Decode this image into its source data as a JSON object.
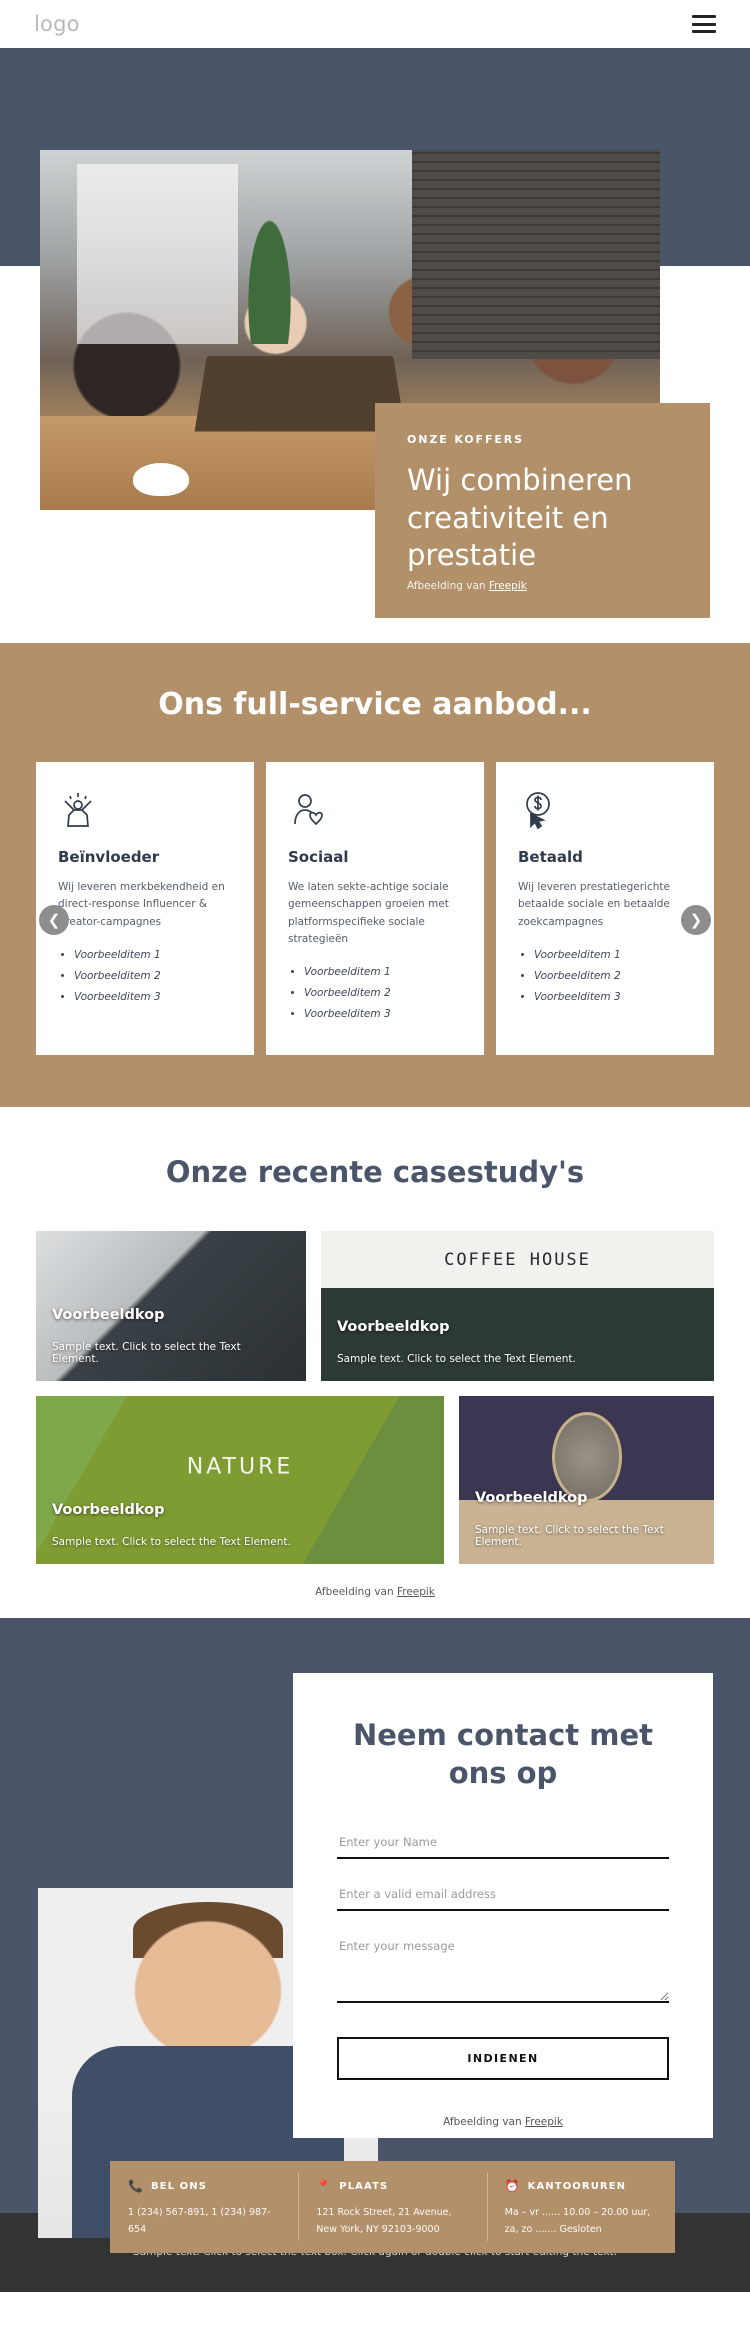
{
  "header": {
    "logo_text": "logo",
    "menu_icon": "hamburger-menu-icon"
  },
  "hero": {
    "eyebrow": "ONZE KOFFERS",
    "title": "Wij combineren creativiteit en prestatie",
    "credit_prefix": "Afbeelding van ",
    "credit_link": "Freepik"
  },
  "services": {
    "heading": "Ons full-service aanbod...",
    "prev_icon": "chevron-left-icon",
    "next_icon": "chevron-right-icon",
    "cards": [
      {
        "icon": "celebration-person-icon",
        "title": "Beïnvloeder",
        "description": "Wij leveren merkbekendheid en direct-response Influencer & Creator-campagnes",
        "items": [
          "Voorbeelditem 1",
          "Voorbeelditem 2",
          "Voorbeelditem 3"
        ]
      },
      {
        "icon": "person-heart-icon",
        "title": "Sociaal",
        "description": "We laten sekte-achtige sociale gemeenschappen groeien met platformspecifieke sociale strategieën",
        "items": [
          "Voorbeelditem 1",
          "Voorbeelditem 2",
          "Voorbeelditem 3"
        ]
      },
      {
        "icon": "dollar-click-icon",
        "title": "Betaald",
        "description": "Wij leveren prestatiegerichte betaalde sociale en betaalde zoekcampagnes",
        "items": [
          "Voorbeelditem 1",
          "Voorbeelditem 2",
          "Voorbeelditem 3"
        ]
      }
    ]
  },
  "cases": {
    "heading": "Onze recente casestudy's",
    "items": [
      {
        "kop": "Voorbeeldkop",
        "sub": "Sample text. Click to select the Text Element."
      },
      {
        "kop": "Voorbeeldkop",
        "sub": "Sample text. Click to select the Text Element.",
        "overlay_text": "COFFEE HOUSE"
      },
      {
        "kop": "Voorbeeldkop",
        "sub": "Sample text. Click to select the Text Element.",
        "overlay_text": "NATURE"
      },
      {
        "kop": "Voorbeeldkop",
        "sub": "Sample text. Click to select the Text Element."
      }
    ],
    "credit_prefix": "Afbeelding van ",
    "credit_link": "Freepik"
  },
  "contact": {
    "heading": "Neem contact met ons op",
    "name_placeholder": "Enter your Name",
    "email_placeholder": "Enter a valid email address",
    "message_placeholder": "Enter your message",
    "submit_label": "INDIENEN",
    "credit_prefix": "Afbeelding van ",
    "credit_link": "Freepik",
    "info": [
      {
        "icon": "phone-icon",
        "title": "BEL ONS",
        "body": "1 (234) 567-891, 1 (234) 987-654"
      },
      {
        "icon": "location-pin-icon",
        "title": "PLAATS",
        "body": "121 Rock Street, 21 Avenue, New York, NY 92103-9000"
      },
      {
        "icon": "clock-icon",
        "title": "KANTOORUREN",
        "body": "Ma – vr ...... 10.00 – 20.00 uur, za, zo ....... Gesloten"
      }
    ]
  },
  "footer": {
    "text": "Sample text. Click to select the text box. Click again or double click to start editing the text."
  }
}
